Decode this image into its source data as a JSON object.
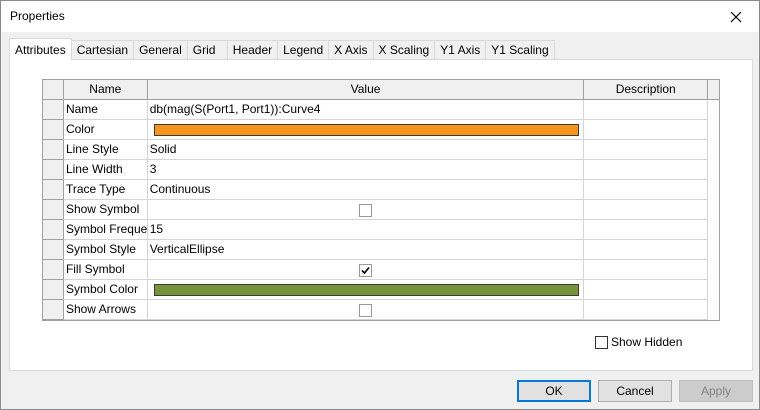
{
  "window": {
    "title": "Properties"
  },
  "tabs": [
    {
      "label": "Attributes",
      "active": true
    },
    {
      "label": "Cartesian"
    },
    {
      "label": "General"
    },
    {
      "label": "Grid"
    },
    {
      "label": "Header"
    },
    {
      "label": "Legend"
    },
    {
      "label": "X Axis"
    },
    {
      "label": "X Scaling"
    },
    {
      "label": "Y1 Axis"
    },
    {
      "label": "Y1 Scaling"
    }
  ],
  "grid": {
    "columns": {
      "name": "Name",
      "value": "Value",
      "description": "Description"
    },
    "rows": [
      {
        "name": "Name",
        "value": "db(mag(S(Port1, Port1)):Curve4"
      },
      {
        "name": "Color",
        "color": "#f7941d"
      },
      {
        "name": "Line Style",
        "value": "Solid"
      },
      {
        "name": "Line Width",
        "value": "3"
      },
      {
        "name": "Trace Type",
        "value": "Continuous"
      },
      {
        "name": "Show Symbol",
        "checked": false
      },
      {
        "name": "Symbol Freque...",
        "value": "15"
      },
      {
        "name": "Symbol Style",
        "value": "VerticalEllipse"
      },
      {
        "name": "Fill Symbol",
        "checked": true
      },
      {
        "name": "Symbol Color",
        "color": "#77933c"
      },
      {
        "name": "Show Arrows",
        "checked": false
      }
    ]
  },
  "show_hidden": {
    "label": "Show Hidden",
    "checked": false
  },
  "buttons": {
    "ok": "OK",
    "cancel": "Cancel",
    "apply": "Apply"
  }
}
